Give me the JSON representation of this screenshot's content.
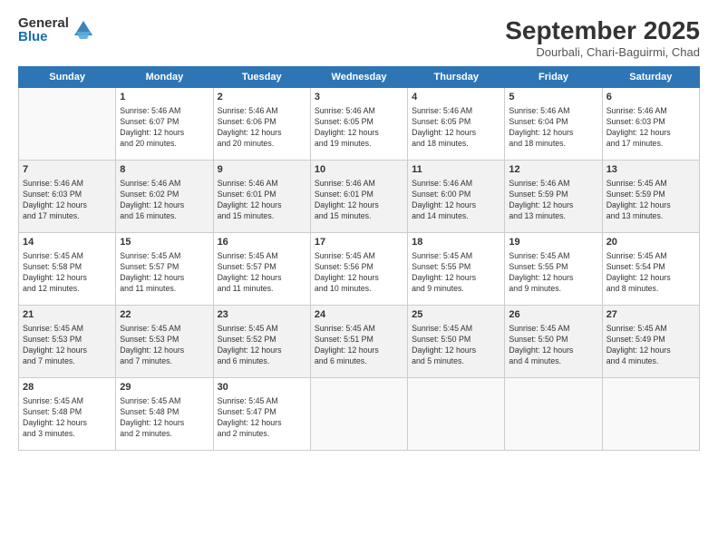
{
  "logo": {
    "general": "General",
    "blue": "Blue"
  },
  "title": "September 2025",
  "location": "Dourbali, Chari-Baguirmi, Chad",
  "headers": [
    "Sunday",
    "Monday",
    "Tuesday",
    "Wednesday",
    "Thursday",
    "Friday",
    "Saturday"
  ],
  "weeks": [
    [
      {
        "num": "",
        "info": ""
      },
      {
        "num": "1",
        "info": "Sunrise: 5:46 AM\nSunset: 6:07 PM\nDaylight: 12 hours\nand 20 minutes."
      },
      {
        "num": "2",
        "info": "Sunrise: 5:46 AM\nSunset: 6:06 PM\nDaylight: 12 hours\nand 20 minutes."
      },
      {
        "num": "3",
        "info": "Sunrise: 5:46 AM\nSunset: 6:05 PM\nDaylight: 12 hours\nand 19 minutes."
      },
      {
        "num": "4",
        "info": "Sunrise: 5:46 AM\nSunset: 6:05 PM\nDaylight: 12 hours\nand 18 minutes."
      },
      {
        "num": "5",
        "info": "Sunrise: 5:46 AM\nSunset: 6:04 PM\nDaylight: 12 hours\nand 18 minutes."
      },
      {
        "num": "6",
        "info": "Sunrise: 5:46 AM\nSunset: 6:03 PM\nDaylight: 12 hours\nand 17 minutes."
      }
    ],
    [
      {
        "num": "7",
        "info": "Sunrise: 5:46 AM\nSunset: 6:03 PM\nDaylight: 12 hours\nand 17 minutes."
      },
      {
        "num": "8",
        "info": "Sunrise: 5:46 AM\nSunset: 6:02 PM\nDaylight: 12 hours\nand 16 minutes."
      },
      {
        "num": "9",
        "info": "Sunrise: 5:46 AM\nSunset: 6:01 PM\nDaylight: 12 hours\nand 15 minutes."
      },
      {
        "num": "10",
        "info": "Sunrise: 5:46 AM\nSunset: 6:01 PM\nDaylight: 12 hours\nand 15 minutes."
      },
      {
        "num": "11",
        "info": "Sunrise: 5:46 AM\nSunset: 6:00 PM\nDaylight: 12 hours\nand 14 minutes."
      },
      {
        "num": "12",
        "info": "Sunrise: 5:46 AM\nSunset: 5:59 PM\nDaylight: 12 hours\nand 13 minutes."
      },
      {
        "num": "13",
        "info": "Sunrise: 5:45 AM\nSunset: 5:59 PM\nDaylight: 12 hours\nand 13 minutes."
      }
    ],
    [
      {
        "num": "14",
        "info": "Sunrise: 5:45 AM\nSunset: 5:58 PM\nDaylight: 12 hours\nand 12 minutes."
      },
      {
        "num": "15",
        "info": "Sunrise: 5:45 AM\nSunset: 5:57 PM\nDaylight: 12 hours\nand 11 minutes."
      },
      {
        "num": "16",
        "info": "Sunrise: 5:45 AM\nSunset: 5:57 PM\nDaylight: 12 hours\nand 11 minutes."
      },
      {
        "num": "17",
        "info": "Sunrise: 5:45 AM\nSunset: 5:56 PM\nDaylight: 12 hours\nand 10 minutes."
      },
      {
        "num": "18",
        "info": "Sunrise: 5:45 AM\nSunset: 5:55 PM\nDaylight: 12 hours\nand 9 minutes."
      },
      {
        "num": "19",
        "info": "Sunrise: 5:45 AM\nSunset: 5:55 PM\nDaylight: 12 hours\nand 9 minutes."
      },
      {
        "num": "20",
        "info": "Sunrise: 5:45 AM\nSunset: 5:54 PM\nDaylight: 12 hours\nand 8 minutes."
      }
    ],
    [
      {
        "num": "21",
        "info": "Sunrise: 5:45 AM\nSunset: 5:53 PM\nDaylight: 12 hours\nand 7 minutes."
      },
      {
        "num": "22",
        "info": "Sunrise: 5:45 AM\nSunset: 5:53 PM\nDaylight: 12 hours\nand 7 minutes."
      },
      {
        "num": "23",
        "info": "Sunrise: 5:45 AM\nSunset: 5:52 PM\nDaylight: 12 hours\nand 6 minutes."
      },
      {
        "num": "24",
        "info": "Sunrise: 5:45 AM\nSunset: 5:51 PM\nDaylight: 12 hours\nand 6 minutes."
      },
      {
        "num": "25",
        "info": "Sunrise: 5:45 AM\nSunset: 5:50 PM\nDaylight: 12 hours\nand 5 minutes."
      },
      {
        "num": "26",
        "info": "Sunrise: 5:45 AM\nSunset: 5:50 PM\nDaylight: 12 hours\nand 4 minutes."
      },
      {
        "num": "27",
        "info": "Sunrise: 5:45 AM\nSunset: 5:49 PM\nDaylight: 12 hours\nand 4 minutes."
      }
    ],
    [
      {
        "num": "28",
        "info": "Sunrise: 5:45 AM\nSunset: 5:48 PM\nDaylight: 12 hours\nand 3 minutes."
      },
      {
        "num": "29",
        "info": "Sunrise: 5:45 AM\nSunset: 5:48 PM\nDaylight: 12 hours\nand 2 minutes."
      },
      {
        "num": "30",
        "info": "Sunrise: 5:45 AM\nSunset: 5:47 PM\nDaylight: 12 hours\nand 2 minutes."
      },
      {
        "num": "",
        "info": ""
      },
      {
        "num": "",
        "info": ""
      },
      {
        "num": "",
        "info": ""
      },
      {
        "num": "",
        "info": ""
      }
    ]
  ]
}
